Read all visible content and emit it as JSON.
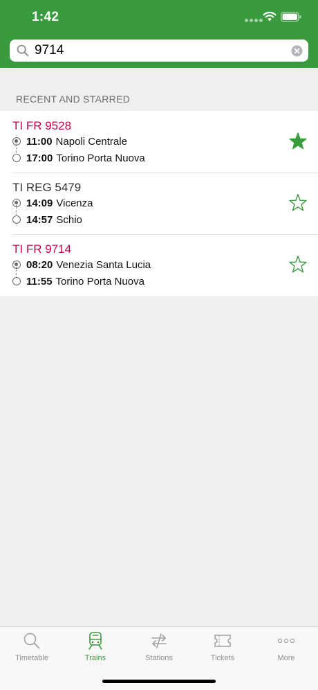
{
  "status_bar": {
    "time": "1:42"
  },
  "search": {
    "value": "9714",
    "placeholder": ""
  },
  "section_header": "RECENT AND STARRED",
  "colors": {
    "brand_green": "#3a9a3e",
    "frecciarossa_red": "#c8004f",
    "regional_text": "#333333"
  },
  "trains": [
    {
      "name": "TI FR 9528",
      "highlight": true,
      "starred": true,
      "departure": {
        "time": "11:00",
        "station": "Napoli Centrale"
      },
      "arrival": {
        "time": "17:00",
        "station": "Torino Porta Nuova"
      }
    },
    {
      "name": "TI REG 5479",
      "highlight": false,
      "starred": false,
      "departure": {
        "time": "14:09",
        "station": "Vicenza"
      },
      "arrival": {
        "time": "14:57",
        "station": "Schio"
      }
    },
    {
      "name": "TI FR 9714",
      "highlight": true,
      "starred": false,
      "departure": {
        "time": "08:20",
        "station": "Venezia Santa Lucia"
      },
      "arrival": {
        "time": "11:55",
        "station": "Torino Porta Nuova"
      }
    }
  ],
  "tabs": [
    {
      "label": "Timetable",
      "icon": "search-icon",
      "active": false
    },
    {
      "label": "Trains",
      "icon": "train-icon",
      "active": true
    },
    {
      "label": "Stations",
      "icon": "stations-icon",
      "active": false
    },
    {
      "label": "Tickets",
      "icon": "ticket-icon",
      "active": false
    },
    {
      "label": "More",
      "icon": "more-icon",
      "active": false
    }
  ]
}
